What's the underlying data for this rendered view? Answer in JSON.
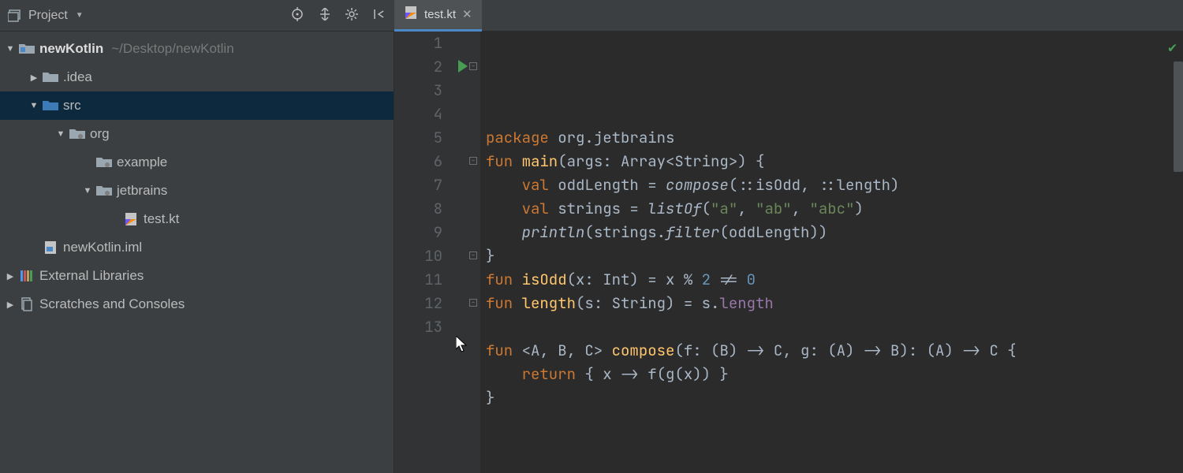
{
  "toolbar": {
    "view_label": "Project"
  },
  "tree": {
    "root": {
      "label": "newKotlin",
      "path": "~/Desktop/newKotlin"
    },
    "idea": ".idea",
    "src": "src",
    "org": "org",
    "example": "example",
    "jetbrains": "jetbrains",
    "file1": "test.kt",
    "iml": "newKotlin.iml",
    "ext": "External Libraries",
    "scratches": "Scratches and Consoles"
  },
  "tab": {
    "label": "test.kt"
  },
  "code": {
    "lines": [
      [
        [
          "kw",
          "package"
        ],
        [
          "pkg",
          " org.jetbrains"
        ]
      ],
      [
        [
          "kw",
          "fun "
        ],
        [
          "fn",
          "main"
        ],
        [
          "pkg",
          "(args: Array<String>) {"
        ]
      ],
      [
        [
          "pkg",
          "    "
        ],
        [
          "kw",
          "val"
        ],
        [
          "pkg",
          " oddLength = "
        ],
        [
          "it",
          "compose"
        ],
        [
          "pkg",
          "(::isOdd, ::length)"
        ]
      ],
      [
        [
          "pkg",
          "    "
        ],
        [
          "kw",
          "val"
        ],
        [
          "pkg",
          " strings = "
        ],
        [
          "it",
          "listOf"
        ],
        [
          "pkg",
          "("
        ],
        [
          "str",
          "\"a\""
        ],
        [
          "pkg",
          ", "
        ],
        [
          "str",
          "\"ab\""
        ],
        [
          "pkg",
          ", "
        ],
        [
          "str",
          "\"abc\""
        ],
        [
          "pkg",
          ")"
        ]
      ],
      [
        [
          "pkg",
          "    "
        ],
        [
          "it",
          "println"
        ],
        [
          "pkg",
          "(strings."
        ],
        [
          "it",
          "filter"
        ],
        [
          "pkg",
          "(oddLength))"
        ]
      ],
      [
        [
          "pkg",
          "}"
        ]
      ],
      [
        [
          "kw",
          "fun "
        ],
        [
          "fn",
          "isOdd"
        ],
        [
          "pkg",
          "(x: Int) = x % "
        ],
        [
          "num",
          "2"
        ],
        [
          "pkg",
          " != "
        ],
        [
          "num",
          "0"
        ]
      ],
      [
        [
          "kw",
          "fun "
        ],
        [
          "fn",
          "length"
        ],
        [
          "pkg",
          "(s: String) = s."
        ],
        [
          "prop",
          "length"
        ]
      ],
      [
        [
          "pkg",
          ""
        ]
      ],
      [
        [
          "kw",
          "fun "
        ],
        [
          "pkg",
          "<A, B, C> "
        ],
        [
          "fn",
          "compose"
        ],
        [
          "pkg",
          "(f: (B) -> C, g: (A) -> B): (A) -> C {"
        ]
      ],
      [
        [
          "pkg",
          "    "
        ],
        [
          "kw",
          "return"
        ],
        [
          "pkg",
          " { x -> f(g(x)) }"
        ]
      ],
      [
        [
          "pkg",
          "}"
        ]
      ],
      [
        [
          "pkg",
          ""
        ]
      ]
    ]
  }
}
